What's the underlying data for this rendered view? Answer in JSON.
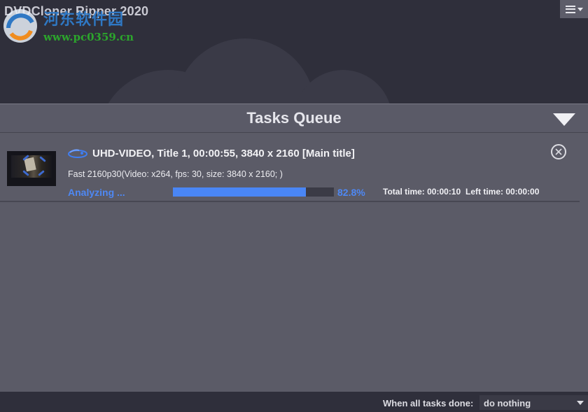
{
  "app": {
    "title": "DVDCloner Ripper 2020"
  },
  "watermark": {
    "site_name": "河东软件园",
    "url": "www.pc0359.cn"
  },
  "menu": {
    "icon": "hamburger-menu-icon"
  },
  "queue": {
    "title": "Tasks Queue",
    "collapse_icon": "triangle-down-icon"
  },
  "task": {
    "source_icon": "bluray-icon",
    "title": "UHD-VIDEO, Title 1, 00:00:55, 3840 x 2160 [Main title]",
    "settings": "Fast 2160p30(Video: x264, fps: 30, size: 3840 x 2160; )",
    "status": "Analyzing ...",
    "progress": 0.828,
    "progress_label": "82.8%",
    "total_time": "Total time: 00:00:10",
    "left_time": "Left time: 00:00:00",
    "remove_icon": "close-circle-icon"
  },
  "footer": {
    "label": "When all tasks done:",
    "action_value": "do nothing"
  },
  "colors": {
    "accent": "#4a86f5",
    "header_bg": "#5a5a67",
    "content_bg": "#5b5b67"
  }
}
